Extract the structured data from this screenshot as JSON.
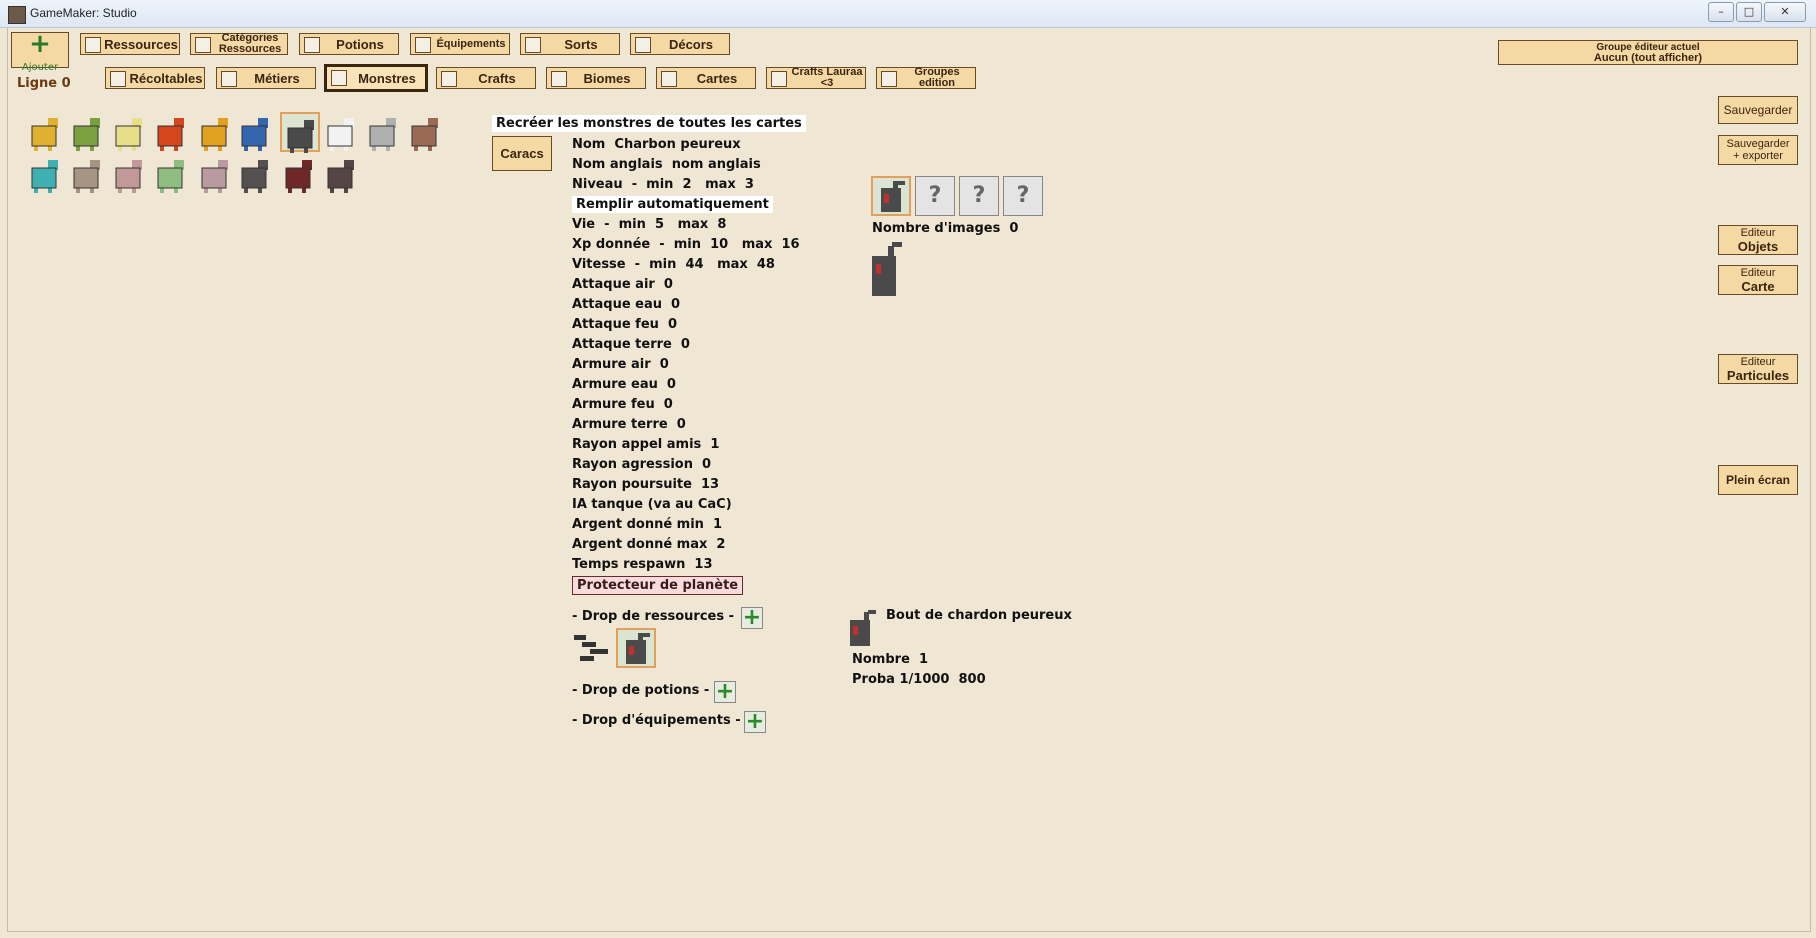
{
  "window": {
    "title": "GameMaker: Studio",
    "controls": [
      "–",
      "□",
      "✕"
    ]
  },
  "toolbar": {
    "add_label": "Ajouter",
    "row1": [
      {
        "label": "Ressources",
        "small": false
      },
      {
        "label": "Catégories Ressources",
        "small": true
      },
      {
        "label": "Potions",
        "small": false
      },
      {
        "label": "Équipements",
        "small": true
      },
      {
        "label": "Sorts",
        "small": false
      },
      {
        "label": "Décors",
        "small": false
      }
    ],
    "row2": [
      {
        "label": "Récoltables",
        "small": false
      },
      {
        "label": "Métiers",
        "small": false
      },
      {
        "label": "Monstres",
        "small": false,
        "active": true
      },
      {
        "label": "Crafts",
        "small": false
      },
      {
        "label": "Biomes",
        "small": false
      },
      {
        "label": "Cartes",
        "small": false
      },
      {
        "label": "Crafts Lauraa <3",
        "small": true
      },
      {
        "label": "Groupes edition",
        "small": true
      }
    ],
    "line_label": "Ligne 0"
  },
  "group_editor": {
    "title": "Groupe éditeur actuel",
    "value": "Aucun (tout afficher)"
  },
  "side_buttons": {
    "save": "Sauvegarder",
    "save_export_1": "Sauvegarder",
    "save_export_2": "+ exporter",
    "editor_word": "Editeur",
    "objects": "Objets",
    "map": "Carte",
    "particles": "Particules",
    "fullscreen": "Plein écran"
  },
  "monster": {
    "recreate_button": "Recréer les monstres de toutes les cartes",
    "caracs_button": "Caracs",
    "name_label": "Nom",
    "name_value": "Charbon peureux",
    "english_name_label": "Nom anglais",
    "english_name_value": "nom anglais",
    "level_label": "Niveau  -  min",
    "level_min": "2",
    "level_max": "3",
    "autofill_button": "Remplir automatiquement",
    "life_label": "Vie  -  min",
    "life_min": "5",
    "life_max": "8",
    "xp_label": "Xp donnée  -  min",
    "xp_min": "10",
    "xp_max": "16",
    "speed_label": "Vitesse  -  min",
    "speed_min": "44",
    "speed_max": "48",
    "max_word": "max",
    "attack_air": "Attaque air  0",
    "attack_water": "Attaque eau  0",
    "attack_fire": "Attaque feu  0",
    "attack_earth": "Attaque terre  0",
    "armor_air": "Armure air  0",
    "armor_water": "Armure eau  0",
    "armor_fire": "Armure feu  0",
    "armor_earth": "Armure terre  0",
    "call_friends": "Rayon appel amis  1",
    "aggression": "Rayon agression  0",
    "pursuit": "Rayon poursuite  13",
    "ai_tank": "IA tanque (va au CaC)",
    "money_min": "Argent donné min  1",
    "money_max": "Argent donné max  2",
    "respawn": "Temps respawn  13",
    "planet_protector": "Protecteur de planète",
    "image_count_label": "Nombre d'images",
    "image_count": "0",
    "image_slots": [
      "?",
      "?",
      "?"
    ],
    "drop_resources": "- Drop de ressources -",
    "drop_potions": "- Drop de potions -",
    "drop_equipment": "- Drop d'équipements -",
    "drop_item_name": "Bout de chardon peureux",
    "drop_number": "Nombre  1",
    "drop_proba": "Proba 1/1000  800"
  },
  "colors": {
    "background": "#f0e6d4",
    "tab": "#f5d9a5",
    "tab_border": "#6a4a25",
    "add_green": "#2a7a2a"
  },
  "sprites": [
    {
      "name": "sprite-yellow-creature",
      "color": "#e0b030"
    },
    {
      "name": "sprite-green-creature",
      "color": "#7aa040"
    },
    {
      "name": "sprite-pale-yellow-creature",
      "color": "#e6df88"
    },
    {
      "name": "sprite-red-creature",
      "color": "#d4461c"
    },
    {
      "name": "sprite-gold-creature",
      "color": "#e2a020"
    },
    {
      "name": "sprite-blue-creature",
      "color": "#3466b0"
    },
    {
      "name": "sprite-charcoal-selected",
      "color": "#4a4a4a"
    },
    {
      "name": "sprite-white-creature",
      "color": "#f2f2f2"
    },
    {
      "name": "sprite-grey-creature",
      "color": "#b0b0b0"
    },
    {
      "name": "sprite-brown-creature",
      "color": "#9a6a55"
    },
    {
      "name": "sprite-teal-creature",
      "color": "#3fb0b2"
    },
    {
      "name": "sprite-tan-creature",
      "color": "#a69582"
    },
    {
      "name": "sprite-pink-creature",
      "color": "#c39898"
    },
    {
      "name": "sprite-green-plant",
      "color": "#8fbd80"
    },
    {
      "name": "sprite-mauve-creature",
      "color": "#b89aa0"
    },
    {
      "name": "sprite-dark-cart",
      "color": "#555050"
    },
    {
      "name": "sprite-dark-red-creature",
      "color": "#6e2828"
    },
    {
      "name": "sprite-dark-grey-creature",
      "color": "#554545"
    }
  ]
}
